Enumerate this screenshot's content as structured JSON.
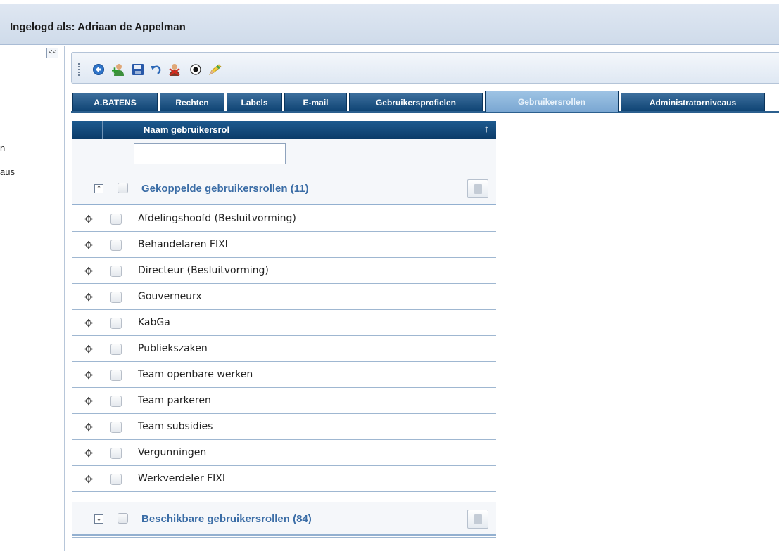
{
  "header": {
    "logged_in_text": "Ingelogd als: Adriaan de Appelman"
  },
  "left_panel": {
    "collapse_label": "<<",
    "items": [
      {
        "label": "n"
      },
      {
        "label": "aus"
      }
    ]
  },
  "toolbar": {
    "icons": [
      "refresh-icon",
      "add-user-icon",
      "save-icon",
      "undo-icon",
      "remove-user-icon",
      "view-icon",
      "edit-icon"
    ]
  },
  "tabs": [
    {
      "label": "A.BATENS",
      "active": false
    },
    {
      "label": "Rechten",
      "active": false
    },
    {
      "label": "Labels",
      "active": false
    },
    {
      "label": "E-mail",
      "active": false
    },
    {
      "label": "Gebruikersprofielen",
      "active": false
    },
    {
      "label": "Gebruikersrollen",
      "active": true
    },
    {
      "label": "Administratorniveaus",
      "active": false
    }
  ],
  "grid": {
    "column_title": "Naam gebruikersrol",
    "sort_indicator": "↑",
    "filter_value": "",
    "linked_group": {
      "title": "Gekoppelde gebruikersrollen (11)",
      "toggle": "⌃"
    },
    "rows": [
      "Afdelingshoofd (Besluitvorming)",
      "Behandelaren FIXI",
      "Directeur (Besluitvorming)",
      "Gouverneurx",
      "KabGa",
      "Publiekszaken",
      "Team openbare werken",
      "Team parkeren",
      "Team subsidies",
      "Vergunningen",
      "Werkverdeler FIXI"
    ],
    "available_group": {
      "title": "Beschikbare gebruikersrollen (84)",
      "toggle": "⌄"
    }
  }
}
